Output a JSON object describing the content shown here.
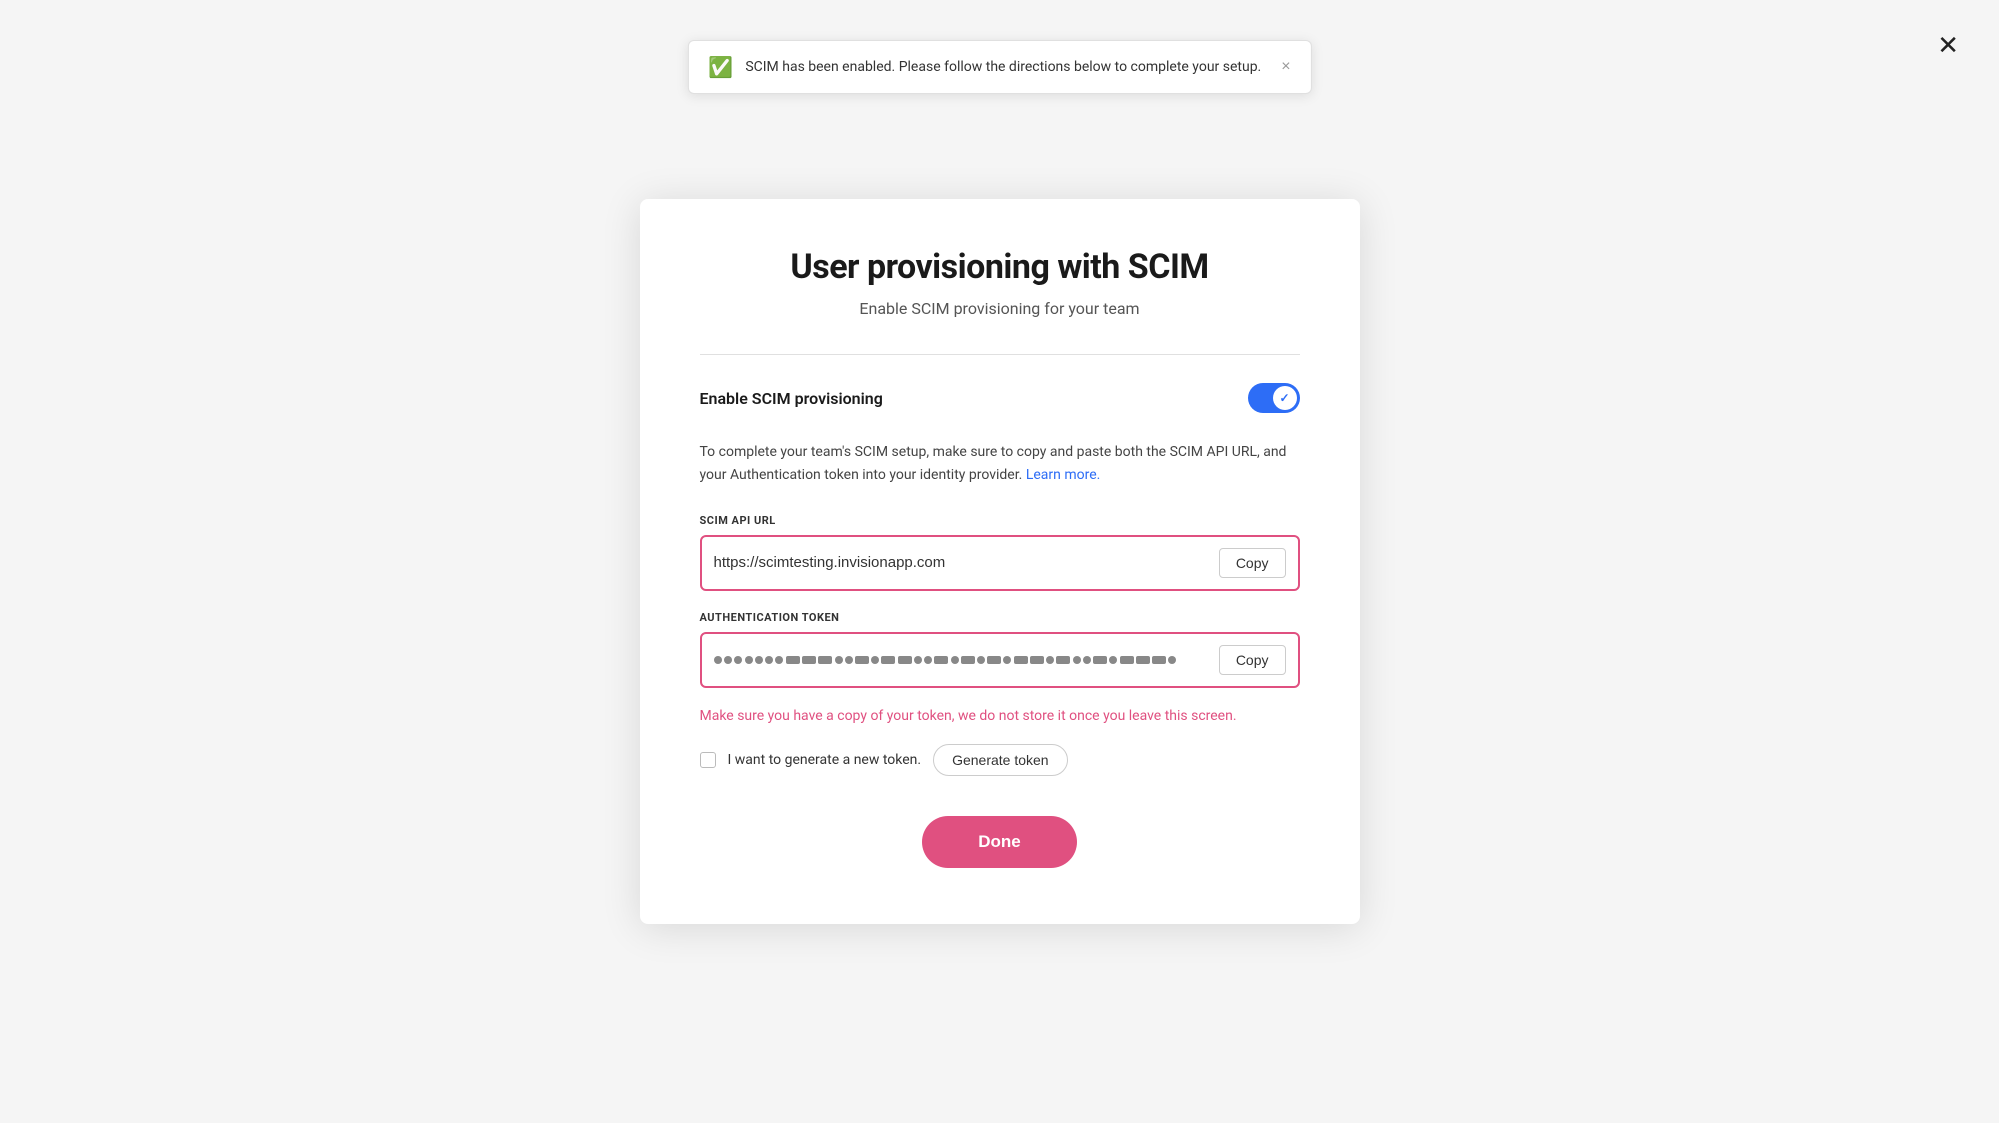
{
  "page": {
    "background": "#f5f5f5"
  },
  "toast": {
    "message": "SCIM has been enabled. Please follow the directions below to complete your setup.",
    "close_label": "×"
  },
  "page_close": "✕",
  "modal": {
    "title": "User provisioning with SCIM",
    "subtitle": "Enable SCIM provisioning for your team",
    "divider": true,
    "toggle": {
      "label": "Enable SCIM provisioning",
      "enabled": true
    },
    "description": {
      "text": "To complete your team's SCIM setup, make sure to copy and paste both the SCIM API URL, and your Authentication token into your identity provider.",
      "link_text": "Learn more.",
      "link_href": "#"
    },
    "scim_api_url": {
      "label": "SCIM API URL",
      "value": "https://scimtesting.invisionapp.com",
      "copy_label": "Copy"
    },
    "auth_token": {
      "label": "Authentication token",
      "copy_label": "Copy"
    },
    "warning": "Make sure you have a copy of your token, we do not store it once you leave this screen.",
    "new_token": {
      "checkbox_label": "I want to generate a new token.",
      "generate_label": "Generate token"
    },
    "done_label": "Done"
  }
}
